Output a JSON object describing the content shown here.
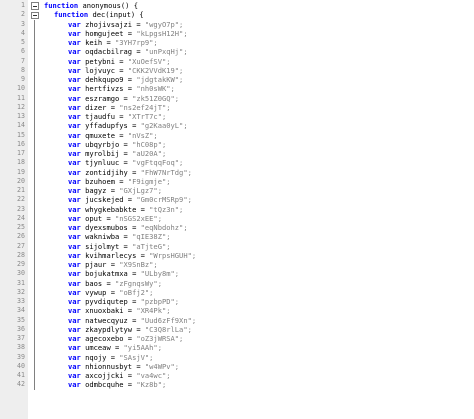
{
  "editor": {
    "colors": {
      "keyword": "#0000ff",
      "string": "#808080",
      "text": "#000000",
      "gutter": "#eeeeee"
    },
    "header_lines": [
      {
        "number": "1",
        "keyword": "function",
        "text": " anonymous() {"
      },
      {
        "number": "2",
        "keyword": "function",
        "text": " dec(input) {"
      }
    ],
    "var_keyword": "var",
    "statements": [
      {
        "number": "3",
        "name": "zhojivsajzi",
        "value": "\"wgyO7p\";"
      },
      {
        "number": "4",
        "name": "homgujeet",
        "value": "\"kLpgsH12H\";"
      },
      {
        "number": "5",
        "name": "keih",
        "value": "\"3YH7rp9\";"
      },
      {
        "number": "6",
        "name": "oqdacbilrag",
        "value": "\"unPxqHj\";"
      },
      {
        "number": "7",
        "name": "petybni",
        "value": "\"XuOefSV\";"
      },
      {
        "number": "8",
        "name": "lojvuyc",
        "value": "\"CKK2VVdK19\";"
      },
      {
        "number": "9",
        "name": "dehkqupo9",
        "value": "\"jdgtakKW\";"
      },
      {
        "number": "10",
        "name": "hertfivzs",
        "value": "\"nh0sWK\";"
      },
      {
        "number": "11",
        "name": "eszramgo",
        "value": "\"zk51Z0GQ\";"
      },
      {
        "number": "12",
        "name": "dizer",
        "value": "\"ns2ef24jT\";"
      },
      {
        "number": "13",
        "name": "tjaudfu",
        "value": "\"XTrT7c\";"
      },
      {
        "number": "14",
        "name": "yffadupfys",
        "value": "\"g2Kaa0yL\";"
      },
      {
        "number": "15",
        "name": "qmuxete",
        "value": "\"nVsZ\";"
      },
      {
        "number": "16",
        "name": "ubqyrbjo",
        "value": "\"hC08p\";"
      },
      {
        "number": "17",
        "name": "myrolbij",
        "value": "\"aU20A\";"
      },
      {
        "number": "18",
        "name": "tjynluuc",
        "value": "\"vgFtqqFoq\";"
      },
      {
        "number": "19",
        "name": "zontidjihy",
        "value": "\"FhW7NrTdg\";"
      },
      {
        "number": "20",
        "name": "bzuhoem",
        "value": "\"F9igmje\";"
      },
      {
        "number": "21",
        "name": "bagyz",
        "value": "\"GXjLgz7\";"
      },
      {
        "number": "22",
        "name": "jucskejed",
        "value": "\"Gm0crMSRp9\";"
      },
      {
        "number": "23",
        "name": "whygkebabkte",
        "value": "\"tQz3n\";"
      },
      {
        "number": "24",
        "name": "oput",
        "value": "\"nSGS2xEE\";"
      },
      {
        "number": "25",
        "name": "dyexsmubos",
        "value": "\"eqNbdohz\";"
      },
      {
        "number": "26",
        "name": "wakniwba",
        "value": "\"qIE38Z\";"
      },
      {
        "number": "27",
        "name": "sijolmyt",
        "value": "\"aTjteG\";"
      },
      {
        "number": "28",
        "name": "kvihmarlecys",
        "value": "\"WrpsHGUH\";"
      },
      {
        "number": "29",
        "name": "pjaur",
        "value": "\"X9SnBz\";"
      },
      {
        "number": "30",
        "name": "bojukatmxa",
        "value": "\"ULby8m\";"
      },
      {
        "number": "31",
        "name": "baos",
        "value": "\"zFgnqsWy\";"
      },
      {
        "number": "32",
        "name": "vywup",
        "value": "\"oBfj2\";"
      },
      {
        "number": "33",
        "name": "pyvdiqutep",
        "value": "\"pzbpPD\";"
      },
      {
        "number": "34",
        "name": "xnuoxbaki",
        "value": "\"XR4Pk\";"
      },
      {
        "number": "35",
        "name": "natwecqyuz",
        "value": "\"Uud6zFf9Xn\";"
      },
      {
        "number": "36",
        "name": "zkaypdlytyw",
        "value": "\"C3Q8rlLa\";"
      },
      {
        "number": "37",
        "name": "agecoxebo",
        "value": "\"oZ3jWRSA\";"
      },
      {
        "number": "38",
        "name": "umceaw",
        "value": "\"yi5AAh\";"
      },
      {
        "number": "39",
        "name": "nqojy",
        "value": "\"SAsjV\";"
      },
      {
        "number": "40",
        "name": "nhionnusbyt",
        "value": "\"w4WPv\";"
      },
      {
        "number": "41",
        "name": "axcojjcki",
        "value": "\"va4wc\";"
      },
      {
        "number": "42",
        "name": "odmbcquhe",
        "value": "\"Kz8b\";"
      }
    ]
  }
}
